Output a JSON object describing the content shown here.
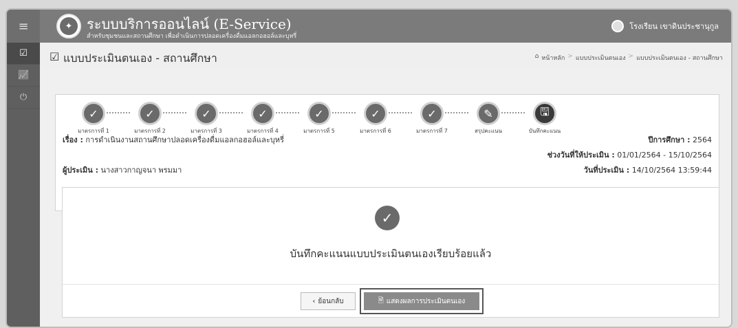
{
  "header": {
    "title": "ระบบบริการออนไลน์ (E-Service)",
    "subtitle": "สำหรับชุมชนและสถานศึกษา เพื่อดำเนินการปลอดเครื่องดื่มแอลกอฮอล์และบุหรี่",
    "user_name": "โรงเรียน เขาดินประชานุกูล"
  },
  "page": {
    "title": "แบบประเมินตนเอง - สถานศึกษา"
  },
  "breadcrumb": [
    "หน้าหลัก",
    "แบบประเมินตนเอง",
    "แบบประเมินตนเอง - สถานศึกษา"
  ],
  "steps": [
    {
      "label": "มาตรการที่ 1"
    },
    {
      "label": "มาตรการที่ 2"
    },
    {
      "label": "มาตรการที่ 3"
    },
    {
      "label": "มาตรการที่ 4"
    },
    {
      "label": "มาตรการที่ 5"
    },
    {
      "label": "มาตรการที่ 6"
    },
    {
      "label": "มาตรการที่ 7"
    },
    {
      "label": "สรุปคะแนน"
    },
    {
      "label": "บันทึกคะแนน"
    }
  ],
  "info": {
    "subject_label": "เรื่อง :",
    "subject_value": "การดำเนินงานสถานศึกษาปลอดเครื่องดื่มแอลกอฮอล์และบุหรี่",
    "year_label": "ปีการศึกษา :",
    "year_value": "2564",
    "period_label": "ช่วงวันที่ให้ประเมิน :",
    "period_value": "01/01/2564 - 15/10/2564",
    "assessor_label": "ผู้ประเมิน :",
    "assessor_value": "นางสาวกาญจนา พรมมา",
    "date_label": "วันที่ประเมิน :",
    "date_value": "14/10/2564 13:59:44"
  },
  "result": {
    "message": "บันทึกคะแนนแบบประเมินตนเองเรียบร้อยแล้ว",
    "back_label": "ย้อนกลับ",
    "show_label": "แสดงผลการประเมินตนเอง"
  },
  "icons": {
    "menu": "hamburger-icon",
    "assess": "check-square-icon",
    "chart": "line-chart-icon",
    "logout": "power-icon"
  },
  "colors": {
    "header": "#7b7b7b",
    "sidebar": "#5f5f5f",
    "step": "#6a6a6a"
  }
}
